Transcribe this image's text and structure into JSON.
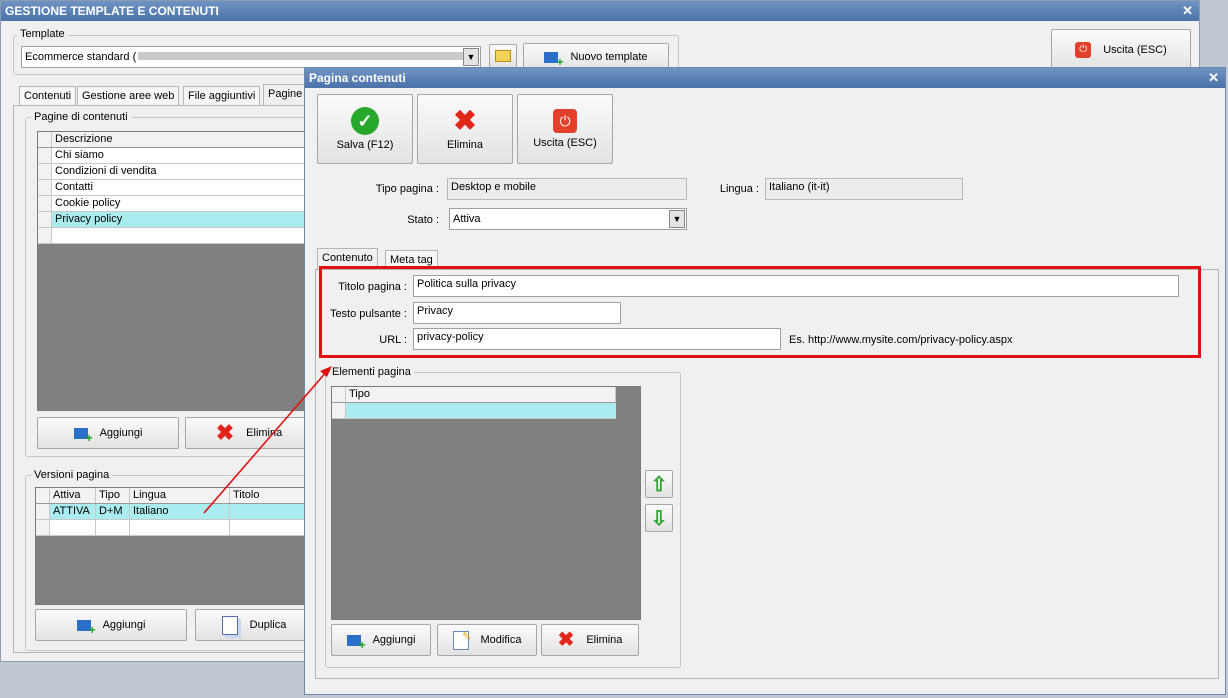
{
  "main_window": {
    "title": "GESTIONE TEMPLATE E CONTENUTI",
    "template_group_label": "Template",
    "template_value": "Ecommerce standard (",
    "new_template_button": "Nuovo template",
    "exit_button": "Uscita (ESC)",
    "tabs": [
      "Contenuti",
      "Gestione aree web",
      "File aggiuntivi",
      "Pagine c"
    ],
    "pages_group_label": "Pagine di contenuti",
    "pages_header": "Descrizione",
    "pages": [
      "Chi siamo",
      "Condizioni di vendita",
      "Contatti",
      "Cookie policy",
      "Privacy policy"
    ],
    "pages_add_button": "Aggiungi",
    "pages_delete_button": "Elimina",
    "versions_group_label": "Versioni pagina",
    "versions_headers": [
      "Attiva",
      "Tipo",
      "Lingua",
      "Titolo"
    ],
    "versions_rows": [
      [
        "ATTIVA",
        "D+M",
        "Italiano",
        ""
      ]
    ],
    "versions_add_button": "Aggiungi",
    "versions_duplicate_button": "Duplica"
  },
  "dialog": {
    "title": "Pagina contenuti",
    "save_button": "Salva (F12)",
    "delete_button": "Elimina",
    "exit_button": "Uscita (ESC)",
    "tipo_label": "Tipo pagina :",
    "tipo_value": "Desktop e mobile",
    "lingua_label": "Lingua :",
    "lingua_value": "Italiano (it-it)",
    "stato_label": "Stato :",
    "stato_value": "Attiva",
    "tabs": [
      "Contenuto",
      "Meta tag"
    ],
    "titolo_label": "Titolo pagina :",
    "titolo_value": "Politica sulla privacy",
    "testo_label": "Testo pulsante :",
    "testo_value": "Privacy",
    "url_label": "URL :",
    "url_value": "privacy-policy",
    "url_hint": "Es. http://www.mysite.com/privacy-policy.aspx",
    "elements_group_label": "Elementi pagina",
    "elements_header": "Tipo",
    "elements_add_button": "Aggiungi",
    "elements_edit_button": "Modifica",
    "elements_delete_button": "Elimina"
  },
  "colors": {
    "highlight_box": "#e01010",
    "selected_row": "#aaecf0",
    "title_bar": "#5a80b5"
  }
}
